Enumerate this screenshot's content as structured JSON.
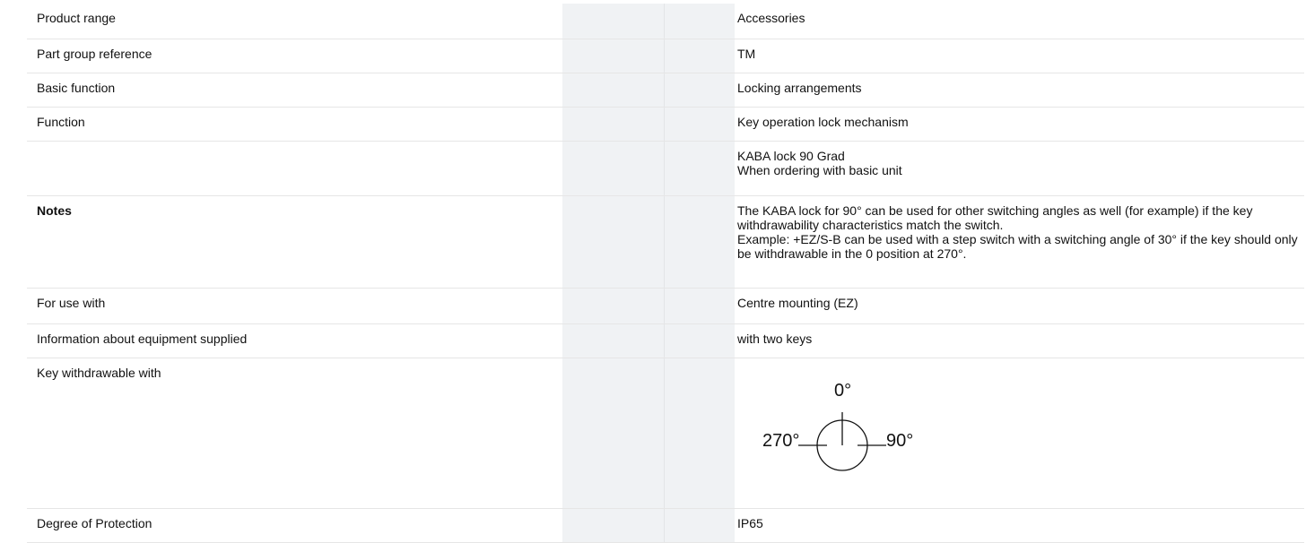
{
  "rows": [
    {
      "label": "Product range",
      "value": "Accessories"
    },
    {
      "label": "Part group reference",
      "value": "TM"
    },
    {
      "label": "Basic function",
      "value": "Locking arrangements"
    },
    {
      "label": "Function",
      "value": "Key operation lock mechanism"
    },
    {
      "label": "",
      "value": "KABA lock 90 Grad\nWhen ordering with basic unit"
    },
    {
      "label": "Notes",
      "value": "The KABA lock for 90° can be used for other switching angles as well (for example) if the key withdrawability characteristics match the switch.\nExample: +EZ/S-B can be used with a step switch with a switching angle of 30° if the key should only be withdrawable in the 0 position at 270°."
    },
    {
      "label": "For use with",
      "value": "Centre mounting (EZ)"
    },
    {
      "label": "Information about equipment supplied",
      "value": "with two keys"
    },
    {
      "label": "Key withdrawable with",
      "diagram": {
        "top": "0°",
        "left": "270°",
        "right": "90°"
      }
    },
    {
      "label": "Degree of Protection",
      "value": "IP65"
    }
  ]
}
